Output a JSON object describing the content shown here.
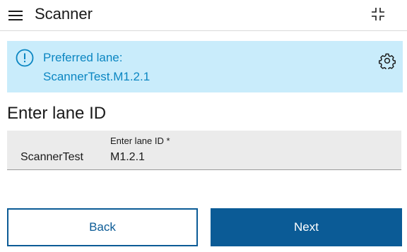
{
  "header": {
    "title": "Scanner",
    "menu_icon": "hamburger-menu-icon",
    "scan_icon": "scan-frame-icon"
  },
  "notice": {
    "icon": "info-icon",
    "label": "Preferred lane:",
    "value": "ScannerTest.M1.2.1",
    "settings_icon": "gear-icon",
    "background_color": "#c9ecfb",
    "text_color": "#0b86c2"
  },
  "form": {
    "heading": "Enter lane ID",
    "prefix": "ScannerTest",
    "field_label": "Enter lane ID *",
    "field_value": "M1.2.1"
  },
  "actions": {
    "back_label": "Back",
    "next_label": "Next",
    "primary_color": "#0b5b96"
  }
}
